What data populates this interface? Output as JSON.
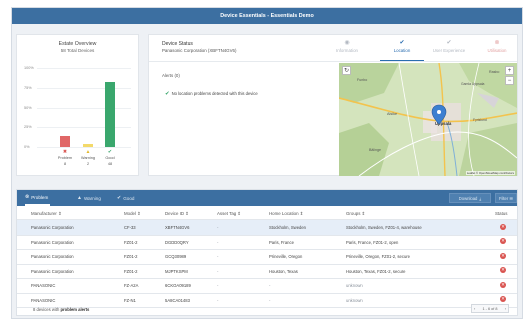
{
  "app": {
    "title": "Device Essentials - Essentials Demo"
  },
  "estate": {
    "title": "Estate Overview",
    "subtitle": "58 Total Devices"
  },
  "chart_data": {
    "type": "bar",
    "categories": [
      "Problem",
      "Warning",
      "Good"
    ],
    "values": [
      8,
      2,
      48
    ],
    "total": 58,
    "ytick_labels": [
      "100%",
      "75%",
      "50%",
      "25%",
      "0%"
    ],
    "ytick_values": [
      100,
      75,
      50,
      25,
      0
    ],
    "ylim": [
      0,
      100
    ],
    "colors": [
      "#e06767",
      "#f3d96a",
      "#3aa76d"
    ],
    "icons": [
      "✖",
      "▲",
      "✔"
    ],
    "icon_colors": [
      "#d9534f",
      "#e3b92f",
      "#3aa76d"
    ]
  },
  "status": {
    "title": "Device Status",
    "device": "Panasonic Corporation (XBFTN4GV6)",
    "tabs": [
      {
        "label": "Information",
        "icon": "◉",
        "active": false
      },
      {
        "label": "Location",
        "icon": "✔",
        "active": true
      },
      {
        "label": "User Experience",
        "icon": "✔",
        "active": false
      },
      {
        "label": "Utilisation",
        "icon": "⊗",
        "active": false
      }
    ],
    "alerts_label": "Alerts (0)",
    "alerts_message": "No location problems detected with this device",
    "map": {
      "labels": [
        "Alsike",
        "Funbo",
        "Bälinge",
        "Rasbo",
        "Gamla Uppsala",
        "Uppsala",
        "Fyrislund"
      ],
      "attribution": "Leaflet © OpenStreetMap contributors"
    }
  },
  "table": {
    "tabs": [
      {
        "label": "Problem",
        "icon": "⊗",
        "active": true
      },
      {
        "label": "Warning",
        "icon": "▲",
        "active": false
      },
      {
        "label": "Good",
        "icon": "✔",
        "active": false
      }
    ],
    "download_label": "Download",
    "filter_label": "Filter",
    "columns": [
      "Manufacturer",
      "Model",
      "Device ID",
      "Asset Tag",
      "Home Location",
      "Groups",
      "Status"
    ],
    "rows": [
      [
        "Panasonic Corporation",
        "CF-33",
        "XBFTN4GV6",
        "-",
        "Stockholm, Sweden",
        "Stockholm, Sweden, FZ01-4, warehouse",
        "problem"
      ],
      [
        "Panasonic Corporation",
        "FZ01-2",
        "DGDD0QRY",
        "-",
        "Paris, France",
        "Paris, France, FZ01-2, open",
        "problem"
      ],
      [
        "Panasonic Corporation",
        "FZ01-2",
        "GCQ30989",
        "-",
        "Prineville, Oregon",
        "Prineville, Oregon, FZ01-2, secure",
        "problem"
      ],
      [
        "Panasonic Corporation",
        "FZ01-2",
        "MJPTKSPM",
        "-",
        "Houston, Texas",
        "Houston, Texas, FZ01-2, secure",
        "problem"
      ],
      [
        "PANASONIC",
        "FZ-A2A",
        "6CKOA09189",
        "-",
        "-",
        "unknown",
        "problem"
      ],
      [
        "PANASONIC",
        "FZ-N1",
        "5A8CA01483",
        "-",
        "-",
        "unknown",
        "problem"
      ]
    ],
    "footer_count": "8 devices with",
    "footer_emph": "problem alerts",
    "pager": "1 - 6 of 8"
  }
}
